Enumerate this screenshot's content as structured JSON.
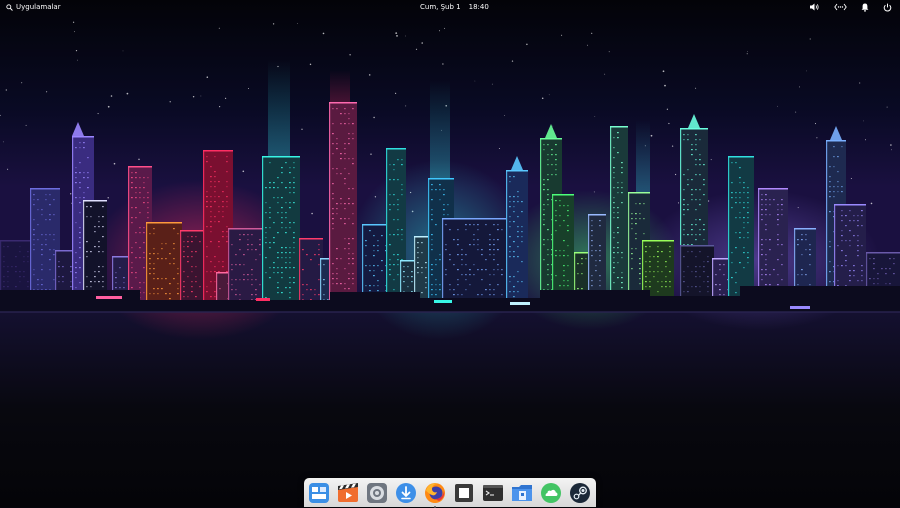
{
  "panel": {
    "applications_label": "Uygulamalar",
    "date": "Cum, Şub 1",
    "time": "18:40",
    "indicators": [
      "volume-icon",
      "network-icon",
      "notifications-icon",
      "power-icon"
    ]
  },
  "dock": {
    "items": [
      {
        "name": "multitasking-view",
        "icon": "multitasking-icon",
        "running": false
      },
      {
        "name": "videos",
        "icon": "video-player-icon",
        "running": false
      },
      {
        "name": "system-settings",
        "icon": "settings-icon",
        "running": false
      },
      {
        "name": "appcenter",
        "icon": "appcenter-icon",
        "running": false
      },
      {
        "name": "firefox",
        "icon": "firefox-icon",
        "running": true
      },
      {
        "name": "screenshot",
        "icon": "screenshot-icon",
        "running": false
      },
      {
        "name": "terminal",
        "icon": "terminal-icon",
        "running": false
      },
      {
        "name": "files",
        "icon": "files-icon",
        "running": false
      },
      {
        "name": "cloud-sync",
        "icon": "cloud-icon",
        "running": false
      },
      {
        "name": "steam",
        "icon": "steam-icon",
        "running": false
      }
    ]
  },
  "wallpaper": {
    "subject": "city-skyline-night",
    "colors": {
      "sky": "#0b0c2a",
      "water": "#07070f",
      "pink": "#ff2e63",
      "cyan": "#38f6e6",
      "green": "#4dff7a",
      "violet": "#9a7bff"
    }
  }
}
